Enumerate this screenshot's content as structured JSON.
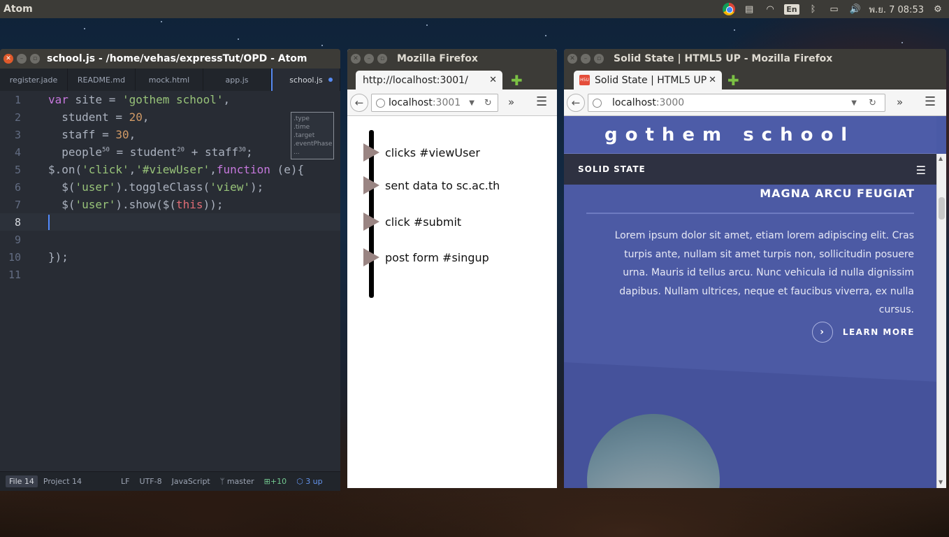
{
  "top_panel": {
    "app_name": "Atom",
    "keyboard_layout": "En",
    "clock": "พ.ย. 7 08:53"
  },
  "atom": {
    "title": "school.js - /home/vehas/expressTut/OPD - Atom",
    "tabs": [
      {
        "label": "register.jade"
      },
      {
        "label": "README.md"
      },
      {
        "label": "mock.html"
      },
      {
        "label": "app.js"
      },
      {
        "label": "school.js",
        "active": true
      }
    ],
    "line_numbers": [
      "1",
      "2",
      "3",
      "4",
      "5",
      "6",
      "7",
      "8",
      "9",
      "10",
      "11"
    ],
    "code": {
      "l1_kw": "var",
      "l1_a": " site = ",
      "l1_str": "'gothem school'",
      "l1_b": ",",
      "l2_a": "  student = ",
      "l2_num": "20",
      "l2_b": ",",
      "l3_a": "  staff = ",
      "l3_num": "30",
      "l3_b": ",",
      "l4_a": "  people",
      "l4_sup1": "50",
      "l4_b": " = student",
      "l4_sup2": "20",
      "l4_c": " + staff",
      "l4_sup3": "30",
      "l4_d": ";",
      "l5_a": "$.on(",
      "l5_s1": "'click'",
      "l5_b": ",",
      "l5_s2": "'#viewUser'",
      "l5_c": ",",
      "l5_kw": "function",
      "l5_d": " (e){",
      "l6_a": "  $(",
      "l6_s1": "'user'",
      "l6_b": ").",
      "l6_fn": "toggleClass",
      "l6_c": "(",
      "l6_s2": "'view'",
      "l6_d": ");",
      "l7_a": "  $(",
      "l7_s1": "'user'",
      "l7_b": ").",
      "l7_fn": "show",
      "l7_c": "($(",
      "l7_th": "this",
      "l7_d": "));",
      "l10": "});"
    },
    "autocomplete": [
      ".type",
      ".time",
      ".target",
      ".eventPhase",
      "..."
    ],
    "status": {
      "file": "File 14",
      "project": "Project 14",
      "line_ending": "LF",
      "encoding": "UTF-8",
      "grammar": "JavaScript",
      "branch": "master",
      "git_added": "+10",
      "updates": "3 up"
    }
  },
  "firefox1": {
    "title": "Mozilla Firefox",
    "tab_label": "http://localhost:3001/",
    "url_host": "localhost",
    "url_port": ":3001",
    "steps": [
      "clicks #viewUser",
      "sent  data to sc.ac.th",
      "click #submit",
      "post  form #singup"
    ]
  },
  "firefox2": {
    "title": "Solid State | HTML5 UP - Mozilla Firefox",
    "tab_label": "Solid State | HTML5 UP",
    "favicon_text": "H5U",
    "url_host": "localhost",
    "url_port": ":3000",
    "site_heading": "gothem   school",
    "nav_brand": "SOLID STATE",
    "section_title": "MAGNA ARCU FEUGIAT",
    "paragraph": "Lorem ipsum dolor sit amet, etiam lorem adipiscing elit. Cras turpis ante, nullam sit amet turpis non, sollicitudin posuere urna. Mauris id tellus arcu. Nunc vehicula id nulla dignissim dapibus. Nullam ultrices, neque et faucibus viverra, ex nulla cursus.",
    "learn_more": "LEARN MORE"
  }
}
